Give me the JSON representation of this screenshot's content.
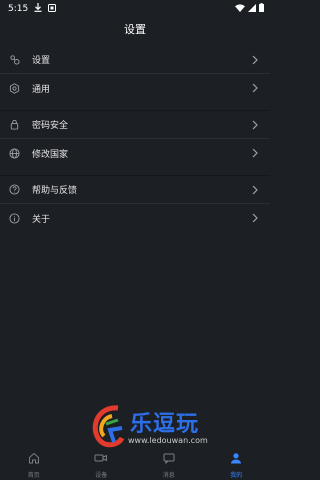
{
  "status_bar": {
    "time": "5:15"
  },
  "app_bar": {
    "title": "设置"
  },
  "menu_groups": [
    {
      "items": [
        {
          "label": "设置",
          "icon": "gear-icon"
        },
        {
          "label": "通用",
          "icon": "settings-alt-icon"
        }
      ]
    },
    {
      "items": [
        {
          "label": "密码安全",
          "icon": "lock-icon"
        },
        {
          "label": "修改国家",
          "icon": "globe-icon"
        }
      ]
    },
    {
      "items": [
        {
          "label": "帮助与反馈",
          "icon": "help-icon"
        },
        {
          "label": "关于",
          "icon": "info-icon"
        }
      ]
    }
  ],
  "watermark": {
    "brand": "乐逗玩",
    "url": "www.ledouwan.com"
  },
  "tab_bar": {
    "items": [
      {
        "label": "首页",
        "icon": "home-icon",
        "active": false
      },
      {
        "label": "设备",
        "icon": "device-icon",
        "active": false
      },
      {
        "label": "消息",
        "icon": "message-icon",
        "active": false
      },
      {
        "label": "我的",
        "icon": "profile-icon",
        "active": true
      }
    ]
  },
  "colors": {
    "background": "#1c1f24",
    "accent": "#3a86ff",
    "text": "#e6e6e6"
  }
}
